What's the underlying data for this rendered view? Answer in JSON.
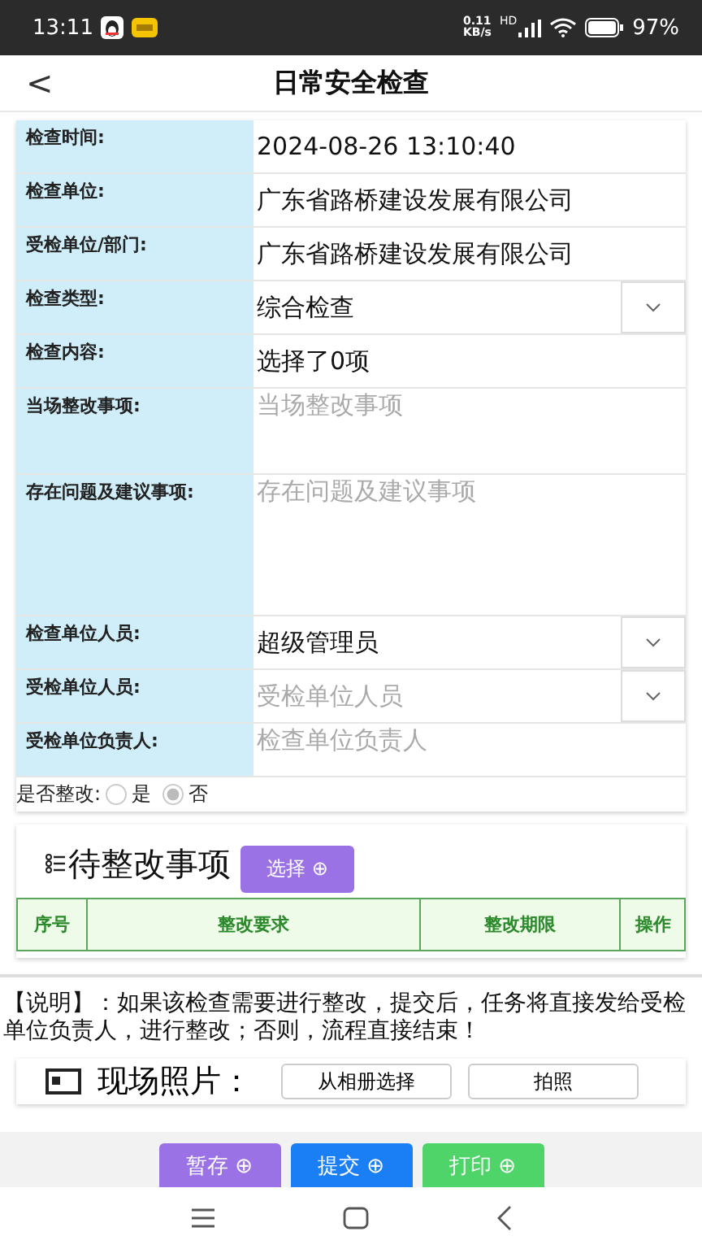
{
  "status_bar": {
    "time": "13:11",
    "net_speed": "0.11",
    "net_unit": "KB/s",
    "signal_tag": "HD",
    "battery": "97%"
  },
  "header": {
    "back": "<",
    "title": "日常安全检查"
  },
  "form": [
    {
      "label": "检查时间:",
      "kind": "text",
      "value": "2024-08-26 13:10:40"
    },
    {
      "label": "检查单位:",
      "kind": "text",
      "value": "广东省路桥建设发展有限公司"
    },
    {
      "label": "受检单位/部门:",
      "kind": "text",
      "value": "广东省路桥建设发展有限公司"
    },
    {
      "label": "检查类型:",
      "kind": "select",
      "value": "综合检查"
    },
    {
      "label": "检查内容:",
      "kind": "text",
      "value": "选择了0项"
    },
    {
      "label": "当场整改事项:",
      "kind": "textarea",
      "placeholder": "当场整改事项"
    },
    {
      "label": "存在问题及建议事项:",
      "kind": "bigarea",
      "placeholder": "存在问题及建议事项"
    },
    {
      "label": "检查单位人员:",
      "kind": "select",
      "value": "超级管理员"
    },
    {
      "label": "受检单位人员:",
      "kind": "select",
      "placeholder": "受检单位人员"
    },
    {
      "label": "受检单位负责人:",
      "kind": "input",
      "placeholder": "检查单位负责人"
    }
  ],
  "rectify": {
    "label": "是否整改:",
    "options": [
      {
        "label": "是",
        "selected": false
      },
      {
        "label": "否",
        "selected": true
      }
    ]
  },
  "pending": {
    "title": "待整改事项",
    "button": "选择 ⊕",
    "columns": [
      "序号",
      "整改要求",
      "整改期限",
      "操作"
    ]
  },
  "note": "【说明】：如果该检查需要进行整改，提交后，任务将直接发给受检单位负责人，进行整改；否则，流程直接结束！",
  "photos": {
    "title": "现场照片：",
    "buttons": [
      "从相册选择",
      "拍照"
    ]
  },
  "actions": [
    {
      "label": "暂存 ⊕",
      "color": "#9a72e6"
    },
    {
      "label": "提交 ⊕",
      "color": "#1a7ff5"
    },
    {
      "label": "打印 ⊕",
      "color": "#4fd46a"
    }
  ]
}
